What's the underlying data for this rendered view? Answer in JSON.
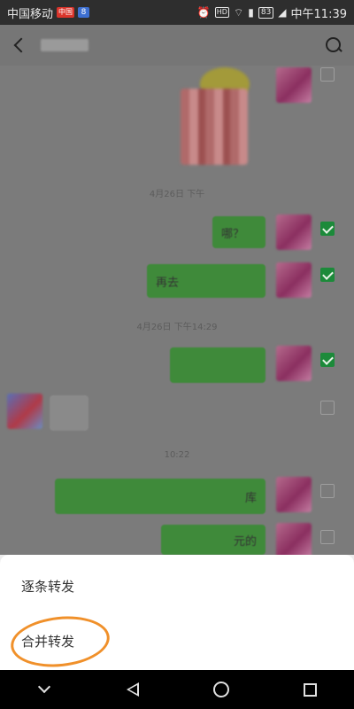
{
  "status_bar": {
    "carrier": "中国移动",
    "badge_red": "中国",
    "badge_blue": "8",
    "hd": "HD",
    "battery": "83",
    "time": "中午11:39"
  },
  "nav": {
    "back_icon": "back-chevron-icon",
    "search_icon": "search-icon"
  },
  "chat": {
    "timestamps": [
      "4月26日 下午",
      "4月26日 下午14:29",
      "10:22"
    ],
    "messages": [
      {
        "text": "哪？",
        "checked": true
      },
      {
        "text": "再去",
        "checked": true
      },
      {
        "text": "",
        "checked": true
      },
      {
        "text": "",
        "checked": false
      },
      {
        "text": "库",
        "checked": false
      },
      {
        "text": "元的",
        "checked": false
      }
    ]
  },
  "sheet": {
    "item_one": "逐条转发",
    "item_two": "合并转发"
  },
  "system_nav": {
    "icons": [
      "collapse-icon",
      "back-triangle-icon",
      "home-circle-icon",
      "recents-square-icon"
    ]
  }
}
